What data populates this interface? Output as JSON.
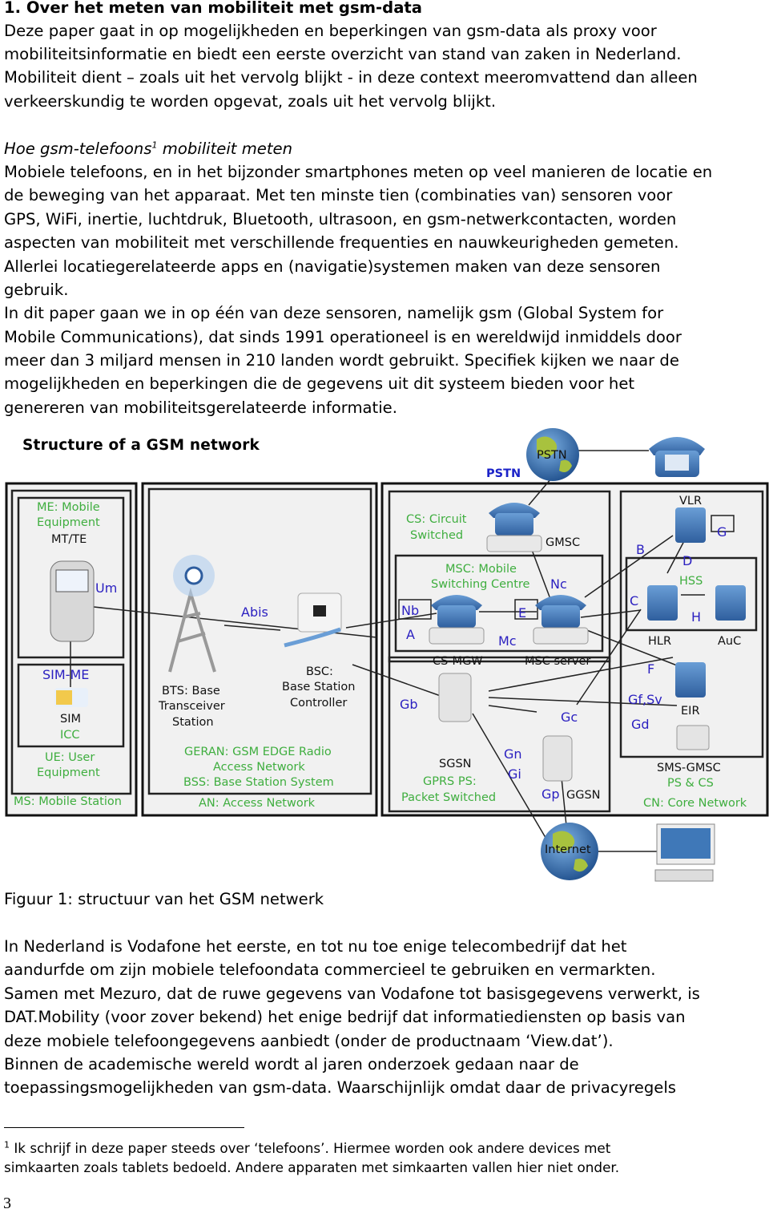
{
  "section": {
    "heading": "1.  Over het meten van mobiliteit met gsm-data",
    "intro": [
      "Deze paper gaat in op mogelijkheden en beperkingen van gsm-data als proxy voor",
      "mobiliteitsinformatie en biedt een eerste overzicht van stand van zaken in Nederland.",
      "Mobiliteit dient – zoals uit het vervolg blijkt - in deze context meeromvattend dan alleen",
      "verkeerskundig te worden opgevat, zoals uit het vervolg blijkt."
    ],
    "subheading": "Hoe gsm-telefoons",
    "subheading_sup": "1",
    "subheading_rest": " mobiliteit meten",
    "para2": [
      "Mobiele telefoons, en in het bijzonder smartphones meten op veel manieren de locatie en",
      "de beweging van het apparaat. Met ten minste tien (combinaties van) sensoren voor",
      "GPS, WiFi, inertie, luchtdruk, Bluetooth, ultrasoon, en gsm-netwerkcontacten, worden",
      "aspecten van mobiliteit met verschillende frequenties en nauwkeurigheden gemeten.",
      "Allerlei locatiegerelateerde apps en (navigatie)systemen maken van deze sensoren",
      "gebruik."
    ],
    "para3": [
      "In dit paper gaan we in op één van deze sensoren, namelijk gsm (Global System for",
      "Mobile Communications), dat sinds 1991 operationeel is en wereldwijd inmiddels door",
      "meer dan 3 miljard mensen in 210 landen wordt gebruikt. Specifiek kijken we naar de",
      "mogelijkheden en beperkingen die de gegevens uit dit systeem bieden voor het",
      "genereren van mobiliteitsgerelateerde informatie."
    ],
    "caption": "Figuur 1: structuur van het GSM netwerk",
    "para4": [
      "In Nederland is Vodafone het eerste, en tot nu toe enige telecombedrijf dat het",
      "aandurfde  om zijn mobiele telefoondata commercieel te gebruiken en vermarkten.",
      "Samen met Mezuro, dat de ruwe gegevens van Vodafone tot basisgegevens verwerkt, is",
      "DAT.Mobility (voor zover bekend) het enige bedrijf dat informatiediensten op basis van",
      "deze mobiele telefoongegevens aanbiedt (onder de productnaam ‘View.dat’).",
      "Binnen de academische wereld wordt al jaren onderzoek gedaan naar de",
      "toepassingsmogelijkheden van gsm-data. Waarschijnlijk omdat daar de privacyregels"
    ]
  },
  "footnote": {
    "mark": "1",
    "lines": [
      " Ik schrijf in deze paper steeds over ‘telefoons’. Hiermee worden ook andere devices met",
      "simkaarten zoals tablets bedoeld. Andere apparaten met simkaarten vallen hier niet onder."
    ]
  },
  "page_number": "3",
  "diagram": {
    "title": "Structure of a GSM network",
    "colors": {
      "domain_label": "#3fae3f",
      "interface_label": "#2a1fc0",
      "icon_blue": "#3f78b8",
      "globe_land": "#9bb83a"
    },
    "labels": {
      "me1": "ME: Mobile",
      "me2": "Equipment",
      "mtte": "MT/TE",
      "um": "Um",
      "simme": "SIM-ME",
      "sim": "SIM",
      "icc": "ICC",
      "ue1": "UE: User",
      "ue2": "Equipment",
      "ms": "MS: Mobile Station",
      "abis": "Abis",
      "bsc1": "BSC:",
      "bsc2": "Base Station",
      "bsc3": "Controller",
      "bts1": "BTS: Base",
      "bts2": "Transceiver",
      "bts3": "Station",
      "geran1": "GERAN: GSM EDGE Radio",
      "geran2": "Access Network",
      "bss": "BSS: Base Station System",
      "an": "AN: Access Network",
      "cs1": "CS: Circuit",
      "cs2": "Switched",
      "gmsc": "GMSC",
      "msc1": "MSC: Mobile",
      "msc2": "Switching Centre",
      "nc": "Nc",
      "nb": "Nb",
      "a": "A",
      "e": "E",
      "mc": "Mc",
      "csmgw": "CS-MGW",
      "mscserver": "MSC server",
      "vlr": "VLR",
      "g": "G",
      "b": "B",
      "d": "D",
      "hss": "HSS",
      "c": "C",
      "h": "H",
      "hlr": "HLR",
      "auc": "AuC",
      "f": "F",
      "gfsv": "Gf,Sv",
      "eir": "EIR",
      "gd": "Gd",
      "gb": "Gb",
      "gc": "Gc",
      "gn": "Gn",
      "gi": "Gi",
      "gp": "Gp",
      "ggsn": "GGSN",
      "sgsn": "SGSN",
      "gprs1": "GPRS PS:",
      "gprs2": "Packet Switched",
      "smsgmsc": "SMS-GMSC",
      "pscs": "PS & CS",
      "cn": "CN: Core Network",
      "internet": "Internet",
      "pstn_globe": "PSTN",
      "pstn": "PSTN"
    }
  }
}
